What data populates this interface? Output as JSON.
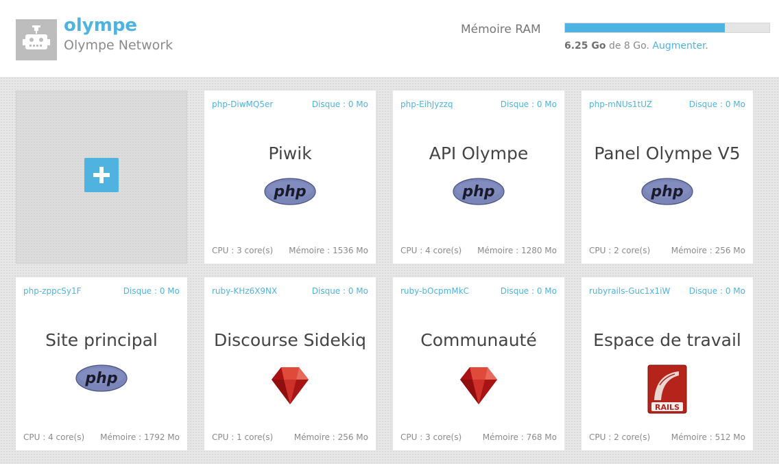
{
  "header": {
    "brand_name": "olympe",
    "brand_sub": "Olympe Network",
    "ram_label": "Mémoire RAM",
    "ram_used": "6.25 Go",
    "ram_of": "de 8 Go.",
    "ram_upgrade": "Augmenter",
    "ram_fraction": 0.78125
  },
  "add_card": {
    "icon": "plus-icon"
  },
  "containers": [
    {
      "id": "php-DiwMQ5er",
      "disk": "Disque : 0 Mo",
      "title": "Piwik",
      "logo": "php-logo",
      "cpu": "CPU : 3 core(s)",
      "mem": "Mémoire : 1536 Mo"
    },
    {
      "id": "php-EihJyzzq",
      "disk": "Disque : 0 Mo",
      "title": "API Olympe",
      "logo": "php-logo",
      "cpu": "CPU : 4 core(s)",
      "mem": "Mémoire : 1280 Mo"
    },
    {
      "id": "php-mNUs1tUZ",
      "disk": "Disque : 0 Mo",
      "title": "Panel Olympe V5",
      "logo": "php-logo",
      "cpu": "CPU : 2 core(s)",
      "mem": "Mémoire : 256 Mo"
    },
    {
      "id": "php-zppcSy1F",
      "disk": "Disque : 0 Mo",
      "title": "Site principal",
      "logo": "php-logo",
      "cpu": "CPU : 4 core(s)",
      "mem": "Mémoire : 1792 Mo"
    },
    {
      "id": "ruby-KHz6X9NX",
      "disk": "Disque : 0 Mo",
      "title": "Discourse Sidekiq",
      "logo": "ruby-logo",
      "cpu": "CPU : 1 core(s)",
      "mem": "Mémoire : 256 Mo"
    },
    {
      "id": "ruby-bOcpmMkC",
      "disk": "Disque : 0 Mo",
      "title": "Communauté",
      "logo": "ruby-logo",
      "cpu": "CPU : 3 core(s)",
      "mem": "Mémoire : 768 Mo"
    },
    {
      "id": "rubyrails-Guc1x1iW",
      "disk": "Disque : 0 Mo",
      "title": "Espace de travail",
      "logo": "rails-logo",
      "cpu": "CPU : 2 core(s)",
      "mem": "Mémoire : 512 Mo"
    }
  ],
  "colors": {
    "accent": "#4fb3e0",
    "php_logo": "#7a86b8",
    "ruby_red": "#c21a1a",
    "rails_red": "#b5241b"
  }
}
